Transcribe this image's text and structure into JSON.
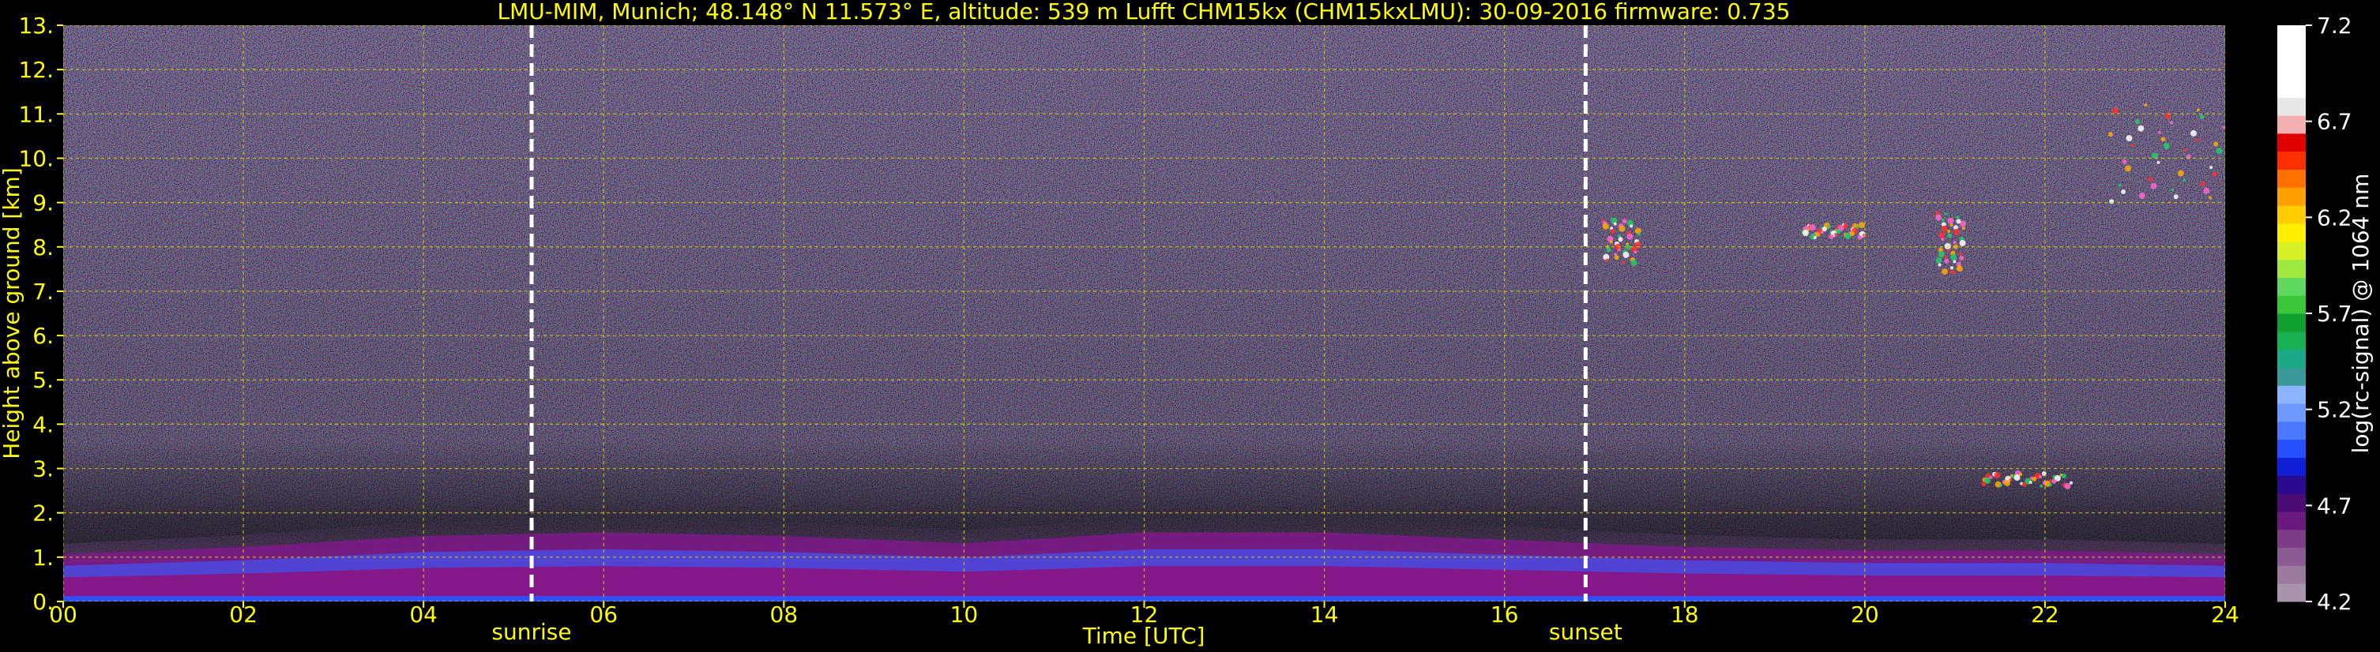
{
  "chart_data": {
    "type": "heatmap",
    "title": "LMU-MIM, Munich; 48.148° N 11.573° E, altitude: 539 m    Lufft CHM15kx (CHM15kxLMU): 30-09-2016    firmware: 0.735",
    "xlabel": "Time [UTC]",
    "ylabel": "Height above ground [km]",
    "colorbar_label": "log(rc-signal) @ 1064 nm",
    "x_ticks": [
      "00",
      "02",
      "04",
      "06",
      "08",
      "10",
      "12",
      "14",
      "16",
      "18",
      "20",
      "22",
      "24"
    ],
    "y_ticks": [
      "0.",
      "1.",
      "2.",
      "3.",
      "4.",
      "5.",
      "6.",
      "7.",
      "8.",
      "9.",
      "10.",
      "11.",
      "12.",
      "13."
    ],
    "colorbar_ticks": [
      "4.2",
      "4.7",
      "5.2",
      "5.7",
      "6.2",
      "6.7",
      "7.2"
    ],
    "xlim": [
      0,
      24
    ],
    "ylim": [
      0,
      13
    ],
    "clim": [
      4.2,
      7.2
    ],
    "grid": true,
    "annotations": [
      {
        "label": "sunrise",
        "x": 5.2
      },
      {
        "label": "sunset",
        "x": 16.9
      }
    ],
    "boundary_layer_top_km": [
      {
        "x": 0,
        "y": 1.3
      },
      {
        "x": 2,
        "y": 1.5
      },
      {
        "x": 4,
        "y": 1.8
      },
      {
        "x": 6,
        "y": 1.9
      },
      {
        "x": 8,
        "y": 1.8
      },
      {
        "x": 10,
        "y": 1.6
      },
      {
        "x": 12,
        "y": 1.9
      },
      {
        "x": 14,
        "y": 1.9
      },
      {
        "x": 16,
        "y": 1.7
      },
      {
        "x": 18,
        "y": 1.5
      },
      {
        "x": 20,
        "y": 1.4
      },
      {
        "x": 22,
        "y": 1.4
      },
      {
        "x": 24,
        "y": 1.3
      }
    ],
    "cloud_features_km": [
      {
        "x_start": 17.1,
        "x_end": 17.5,
        "y_bottom": 7.6,
        "y_top": 8.6
      },
      {
        "x_start": 19.3,
        "x_end": 20.0,
        "y_bottom": 8.2,
        "y_top": 8.5
      },
      {
        "x_start": 20.8,
        "x_end": 21.1,
        "y_bottom": 7.4,
        "y_top": 8.8
      },
      {
        "x_start": 21.3,
        "x_end": 22.3,
        "y_bottom": 2.6,
        "y_top": 2.9
      },
      {
        "x_start": 22.7,
        "x_end": 24.0,
        "y_bottom": 9.0,
        "y_top": 11.2
      }
    ],
    "colors": {
      "annotation": "#ffff00",
      "colorbar_text": "#ffffff",
      "grid": "#d8d800",
      "marker_line": "#ffffff"
    }
  }
}
